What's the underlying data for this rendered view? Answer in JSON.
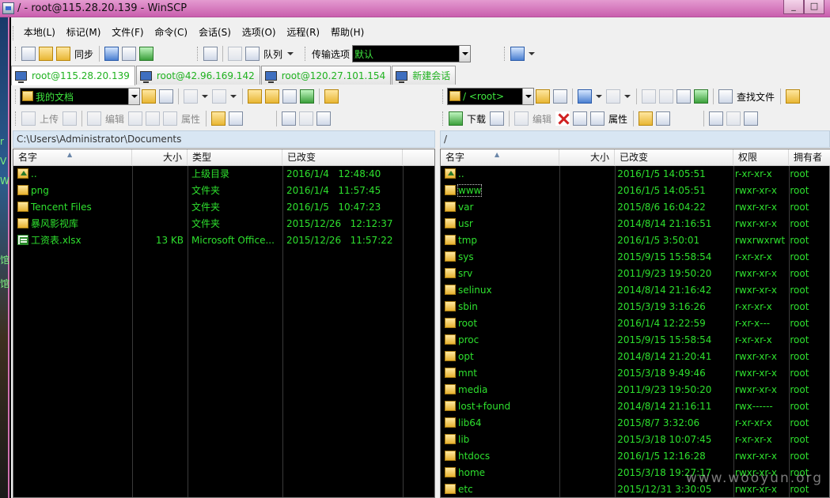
{
  "window": {
    "title": "/ - root@115.28.20.139 - WinSCP",
    "min": "_",
    "max": "□",
    "close": "✕"
  },
  "menu": [
    "本地(L)",
    "标记(M)",
    "文件(F)",
    "命令(C)",
    "会话(S)",
    "选项(O)",
    "远程(R)",
    "帮助(H)"
  ],
  "toolbar": {
    "sync_label": "同步",
    "queue_label": "队列",
    "transfer_label": "传输选项",
    "transfer_value": "默认"
  },
  "tabs": [
    "root@115.28.20.139",
    "root@42.96.169.142",
    "root@120.27.101.154",
    "新建会话"
  ],
  "local": {
    "folder_combo": "我的文档",
    "upload_label": "上传",
    "edit_label": "编辑",
    "props_label": "属性",
    "path": "C:\\Users\\Administrator\\Documents",
    "columns": [
      "名字",
      "大小",
      "类型",
      "已改变"
    ],
    "rows": [
      {
        "name": "..",
        "size": "",
        "type": "上级目录",
        "changed": "2016/1/4   12:48:40",
        "icon": "up"
      },
      {
        "name": "png",
        "size": "",
        "type": "文件夹",
        "changed": "2016/1/4   11:57:45",
        "icon": "folder"
      },
      {
        "name": "Tencent Files",
        "size": "",
        "type": "文件夹",
        "changed": "2016/1/5   10:47:23",
        "icon": "folder"
      },
      {
        "name": "暴风影视库",
        "size": "",
        "type": "文件夹",
        "changed": "2015/12/26   12:12:37",
        "icon": "folder"
      },
      {
        "name": "工资表.xlsx",
        "size": "13 KB",
        "type": "Microsoft Office...",
        "changed": "2015/12/26   11:57:22",
        "icon": "xls"
      }
    ]
  },
  "remote": {
    "folder_combo": "/ <root>",
    "find_label": "查找文件",
    "download_label": "下载",
    "edit_label": "编辑",
    "props_label": "属性",
    "path": "/",
    "columns": [
      "名字",
      "大小",
      "已改变",
      "权限",
      "拥有者"
    ],
    "rows": [
      {
        "name": "..",
        "size": "",
        "changed": "2016/1/5 14:05:51",
        "rights": "r-xr-xr-x",
        "owner": "root",
        "icon": "up"
      },
      {
        "name": "www",
        "size": "",
        "changed": "2016/1/5 14:05:51",
        "rights": "rwxr-xr-x",
        "owner": "root",
        "icon": "folder",
        "selected": true
      },
      {
        "name": "var",
        "size": "",
        "changed": "2015/8/6 16:04:22",
        "rights": "rwxr-xr-x",
        "owner": "root",
        "icon": "folder"
      },
      {
        "name": "usr",
        "size": "",
        "changed": "2014/8/14 21:16:51",
        "rights": "rwxr-xr-x",
        "owner": "root",
        "icon": "folder"
      },
      {
        "name": "tmp",
        "size": "",
        "changed": "2016/1/5 3:50:01",
        "rights": "rwxrwxrwt",
        "owner": "root",
        "icon": "folder"
      },
      {
        "name": "sys",
        "size": "",
        "changed": "2015/9/15 15:58:54",
        "rights": "r-xr-xr-x",
        "owner": "root",
        "icon": "folder"
      },
      {
        "name": "srv",
        "size": "",
        "changed": "2011/9/23 19:50:20",
        "rights": "rwxr-xr-x",
        "owner": "root",
        "icon": "folder"
      },
      {
        "name": "selinux",
        "size": "",
        "changed": "2014/8/14 21:16:42",
        "rights": "rwxr-xr-x",
        "owner": "root",
        "icon": "folder"
      },
      {
        "name": "sbin",
        "size": "",
        "changed": "2015/3/19 3:16:26",
        "rights": "r-xr-xr-x",
        "owner": "root",
        "icon": "folder"
      },
      {
        "name": "root",
        "size": "",
        "changed": "2016/1/4 12:22:59",
        "rights": "r-xr-x---",
        "owner": "root",
        "icon": "folder"
      },
      {
        "name": "proc",
        "size": "",
        "changed": "2015/9/15 15:58:54",
        "rights": "r-xr-xr-x",
        "owner": "root",
        "icon": "folder"
      },
      {
        "name": "opt",
        "size": "",
        "changed": "2014/8/14 21:20:41",
        "rights": "rwxr-xr-x",
        "owner": "root",
        "icon": "folder"
      },
      {
        "name": "mnt",
        "size": "",
        "changed": "2015/3/18 9:49:46",
        "rights": "rwxr-xr-x",
        "owner": "root",
        "icon": "folder"
      },
      {
        "name": "media",
        "size": "",
        "changed": "2011/9/23 19:50:20",
        "rights": "rwxr-xr-x",
        "owner": "root",
        "icon": "folder"
      },
      {
        "name": "lost+found",
        "size": "",
        "changed": "2014/8/14 21:16:11",
        "rights": "rwx------",
        "owner": "root",
        "icon": "folder"
      },
      {
        "name": "lib64",
        "size": "",
        "changed": "2015/8/7 3:32:06",
        "rights": "r-xr-xr-x",
        "owner": "root",
        "icon": "folder"
      },
      {
        "name": "lib",
        "size": "",
        "changed": "2015/3/18 10:07:45",
        "rights": "r-xr-xr-x",
        "owner": "root",
        "icon": "folder"
      },
      {
        "name": "htdocs",
        "size": "",
        "changed": "2016/1/5 12:16:28",
        "rights": "rwxr-xr-x",
        "owner": "root",
        "icon": "folder"
      },
      {
        "name": "home",
        "size": "",
        "changed": "2015/3/18 19:27:17",
        "rights": "rwxr-xr-x",
        "owner": "root",
        "icon": "folder"
      },
      {
        "name": "etc",
        "size": "",
        "changed": "2015/12/31 3:30:05",
        "rights": "rwxr-xr-x",
        "owner": "root",
        "icon": "folder"
      }
    ]
  },
  "watermark": "www.wooyun.org",
  "colors": {
    "list_bg": "#000000",
    "list_text": "#2ee02e",
    "title_bar": "#d774bd",
    "path_bar": "#d8e6f3"
  }
}
